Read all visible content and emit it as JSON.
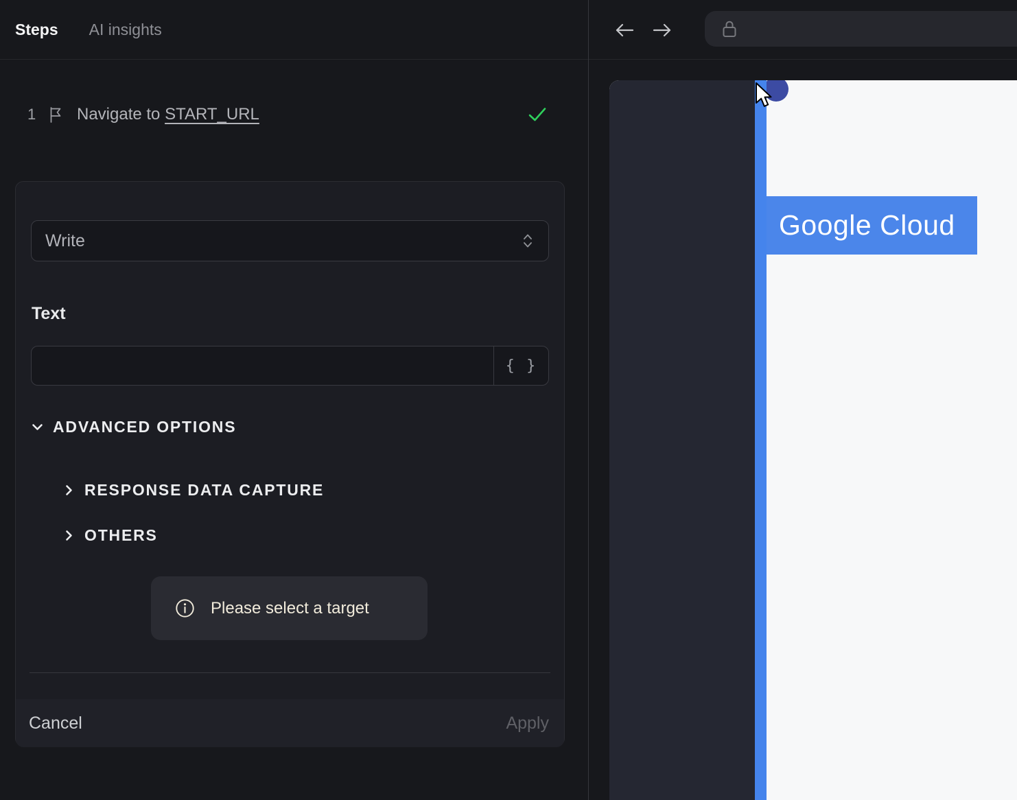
{
  "left_panel": {
    "tabs": [
      {
        "label": "Steps",
        "active": true
      },
      {
        "label": "AI insights",
        "active": false
      }
    ],
    "step": {
      "index": "1",
      "icon": "flag-icon",
      "prefix": "Navigate to ",
      "link": "START_URL",
      "status_icon": "check-icon",
      "status": "success"
    },
    "editor": {
      "action_select": {
        "value": "Write",
        "icon": "unfold-icon"
      },
      "text_field": {
        "label": "Text",
        "value": "",
        "placeholder": "",
        "variable_button": "{ }"
      },
      "advanced": {
        "label": "ADVANCED OPTIONS",
        "expanded": true,
        "sections": [
          {
            "label": "RESPONSE DATA CAPTURE",
            "expanded": false
          },
          {
            "label": "OTHERS",
            "expanded": false
          }
        ]
      },
      "hint": {
        "icon": "info-icon",
        "text": "Please select a target"
      },
      "footer": {
        "cancel_label": "Cancel",
        "apply_label": "Apply",
        "apply_enabled": false
      }
    }
  },
  "browser_panel": {
    "nav": {
      "back_icon": "arrow-left-icon",
      "forward_icon": "arrow-right-icon"
    },
    "address_bar": {
      "lock_icon": "lock-icon",
      "value": ""
    },
    "page": {
      "brand_label": "Google Cloud"
    }
  },
  "colors": {
    "panel_bg": "#17181c",
    "card_bg": "#1c1d23",
    "footer_bg": "#202128",
    "hint_bg": "#2a2b32",
    "hint_text": "#f1ebdb",
    "accent_blue": "#4584ec",
    "banner_blue": "#4b86ea",
    "selection_indigo": "#3c4ba3",
    "success_green": "#2fd05c",
    "page_white": "#f7f8f9",
    "site_sidebar": "#252732"
  }
}
